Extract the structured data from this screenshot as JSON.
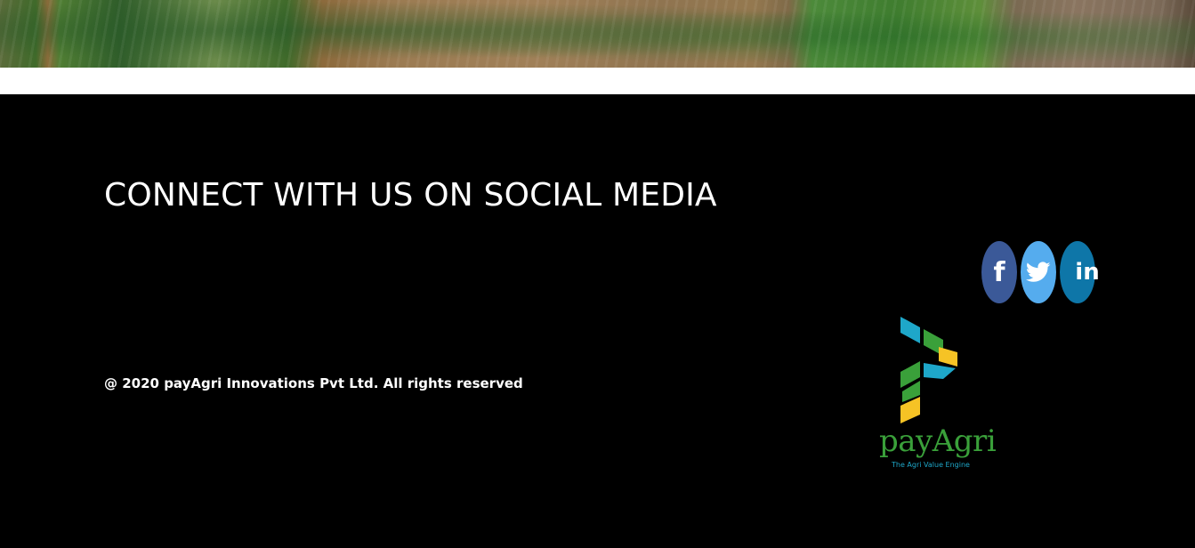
{
  "hero": {
    "image_desc": "aerial-river-fields"
  },
  "footer": {
    "heading": "CONNECT WITH US ON SOCIAL MEDIA",
    "copyright": "@ 2020 payAgri Innovations Pvt Ltd. All rights reserved"
  },
  "social": {
    "facebook": {
      "icon": "facebook-icon",
      "glyph": "f",
      "color": "#3b5998"
    },
    "twitter": {
      "icon": "twitter-icon",
      "color": "#55acee"
    },
    "linkedin": {
      "icon": "linkedin-icon",
      "glyph": "in",
      "color": "#0e76a8"
    }
  },
  "logo": {
    "wordmark": "payAgri",
    "tagline": "The Agri Value Engine",
    "colors": {
      "blue": "#1ea7c9",
      "green": "#3aa03a",
      "yellow": "#f6c325"
    }
  }
}
